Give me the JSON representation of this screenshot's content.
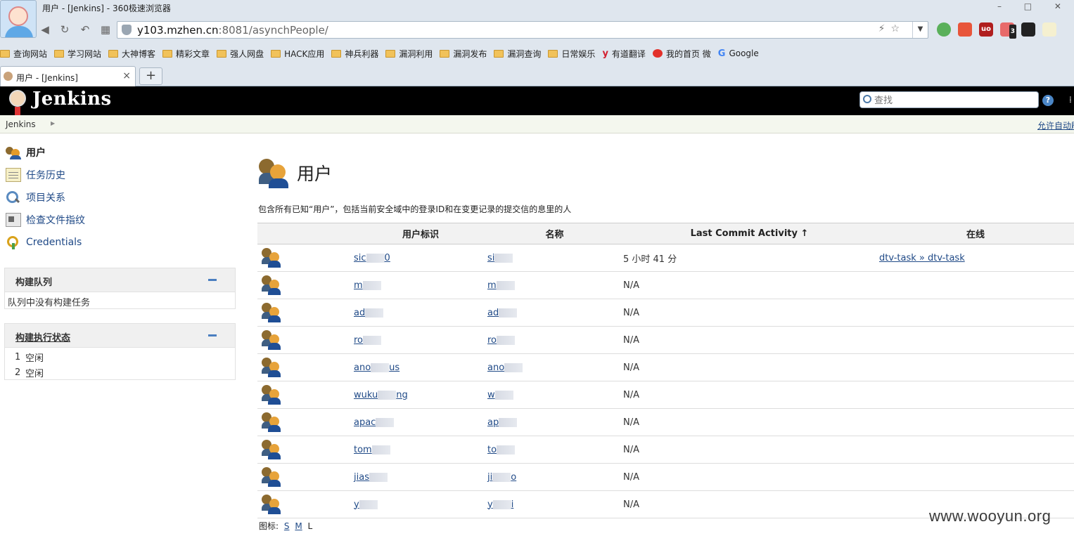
{
  "browser": {
    "window_title": "用户 - [Jenkins] - 360极速浏览器",
    "url_host": "y103.mzhen.cn",
    "url_rest": ":8081/asynchPeople/",
    "bookmarks": [
      "查询网站",
      "学习网站",
      "大神博客",
      "精彩文章",
      "强人网盘",
      "HACK应用",
      "神兵利器",
      "漏洞利用",
      "漏洞发布",
      "漏洞查询",
      "日常娱乐",
      "有道翻译",
      "我的首页 微",
      "Google"
    ],
    "tab_label": "用户 - [Jenkins]",
    "tab_close": "×",
    "new_tab": "+",
    "ext_badge": "3"
  },
  "jenkins": {
    "brand": "Jenkins",
    "search_placeholder": "查找",
    "help": "?",
    "breadcrumb": "Jenkins",
    "breadcrumb_right": "允许自动刷"
  },
  "sidebar": {
    "tasks": [
      {
        "label": "用户",
        "icon": "users-icon"
      },
      {
        "label": "任务历史",
        "icon": "notepad-icon"
      },
      {
        "label": "项目关系",
        "icon": "search-icon"
      },
      {
        "label": "检查文件指纹",
        "icon": "fingerprint-icon"
      },
      {
        "label": "Credentials",
        "icon": "credentials-icon"
      }
    ],
    "build_queue": {
      "title": "构建队列",
      "empty_text": "队列中没有构建任务"
    },
    "executors": {
      "title": "构建执行状态",
      "items": [
        {
          "num": "1",
          "status": "空闲"
        },
        {
          "num": "2",
          "status": "空闲"
        }
      ]
    }
  },
  "main": {
    "title": "用户",
    "description": "包含所有已知“用户”，包括当前安全域中的登录ID和在变更记录的提交信的息里的人",
    "columns": [
      "用户标识",
      "名称",
      "Last Commit Activity ↑",
      "在线"
    ],
    "rows": [
      {
        "id": "sic",
        "id_tail": "0",
        "name": "si",
        "name_tail": "",
        "commit": "5 小时 41 分",
        "online": "dtv-task » dtv-task"
      },
      {
        "id": "m",
        "id_tail": "",
        "name": "m",
        "name_tail": "",
        "commit": "N/A",
        "online": ""
      },
      {
        "id": "ad",
        "id_tail": "",
        "name": "ad",
        "name_tail": "",
        "commit": "N/A",
        "online": ""
      },
      {
        "id": "ro",
        "id_tail": "",
        "name": "ro",
        "name_tail": "",
        "commit": "N/A",
        "online": ""
      },
      {
        "id": "ano",
        "id_tail": "us",
        "name": "ano",
        "name_tail": "",
        "commit": "N/A",
        "online": ""
      },
      {
        "id": "wuku",
        "id_tail": "ng",
        "name": "w",
        "name_tail": "",
        "commit": "N/A",
        "online": ""
      },
      {
        "id": "apac",
        "id_tail": "",
        "name": "ap",
        "name_tail": "",
        "commit": "N/A",
        "online": ""
      },
      {
        "id": "tom",
        "id_tail": "",
        "name": "to",
        "name_tail": "",
        "commit": "N/A",
        "online": ""
      },
      {
        "id": "jias",
        "id_tail": "",
        "name": "ji",
        "name_tail": "o",
        "commit": "N/A",
        "online": ""
      },
      {
        "id": "y",
        "id_tail": "",
        "name": "y",
        "name_tail": "i",
        "commit": "N/A",
        "online": ""
      }
    ],
    "legend_label": "图标:",
    "legend_sizes": [
      "S",
      "M",
      "L"
    ]
  },
  "watermark": "www.wooyun.org"
}
